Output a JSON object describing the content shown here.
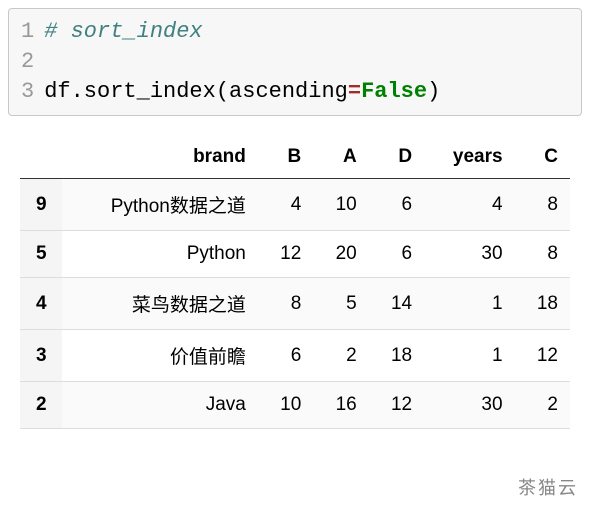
{
  "code": {
    "line1": "# sort_index",
    "line3_prefix": "df.sort_index(ascending",
    "line3_operator": "=",
    "line3_keyword": "False",
    "line3_suffix": ")"
  },
  "line_numbers": [
    "1",
    "2",
    "3"
  ],
  "chart_data": {
    "type": "table",
    "columns": [
      "",
      "brand",
      "B",
      "A",
      "D",
      "years",
      "C"
    ],
    "rows": [
      {
        "index": "9",
        "brand": "Python数据之道",
        "B": "4",
        "A": "10",
        "D": "6",
        "years": "4",
        "C": "8"
      },
      {
        "index": "5",
        "brand": "Python",
        "B": "12",
        "A": "20",
        "D": "6",
        "years": "30",
        "C": "8"
      },
      {
        "index": "4",
        "brand": "菜鸟数据之道",
        "B": "8",
        "A": "5",
        "D": "14",
        "years": "1",
        "C": "18"
      },
      {
        "index": "3",
        "brand": "价值前瞻",
        "B": "6",
        "A": "2",
        "D": "18",
        "years": "1",
        "C": "12"
      },
      {
        "index": "2",
        "brand": "Java",
        "B": "10",
        "A": "16",
        "D": "12",
        "years": "30",
        "C": "2"
      }
    ]
  },
  "watermark": "茶猫云"
}
